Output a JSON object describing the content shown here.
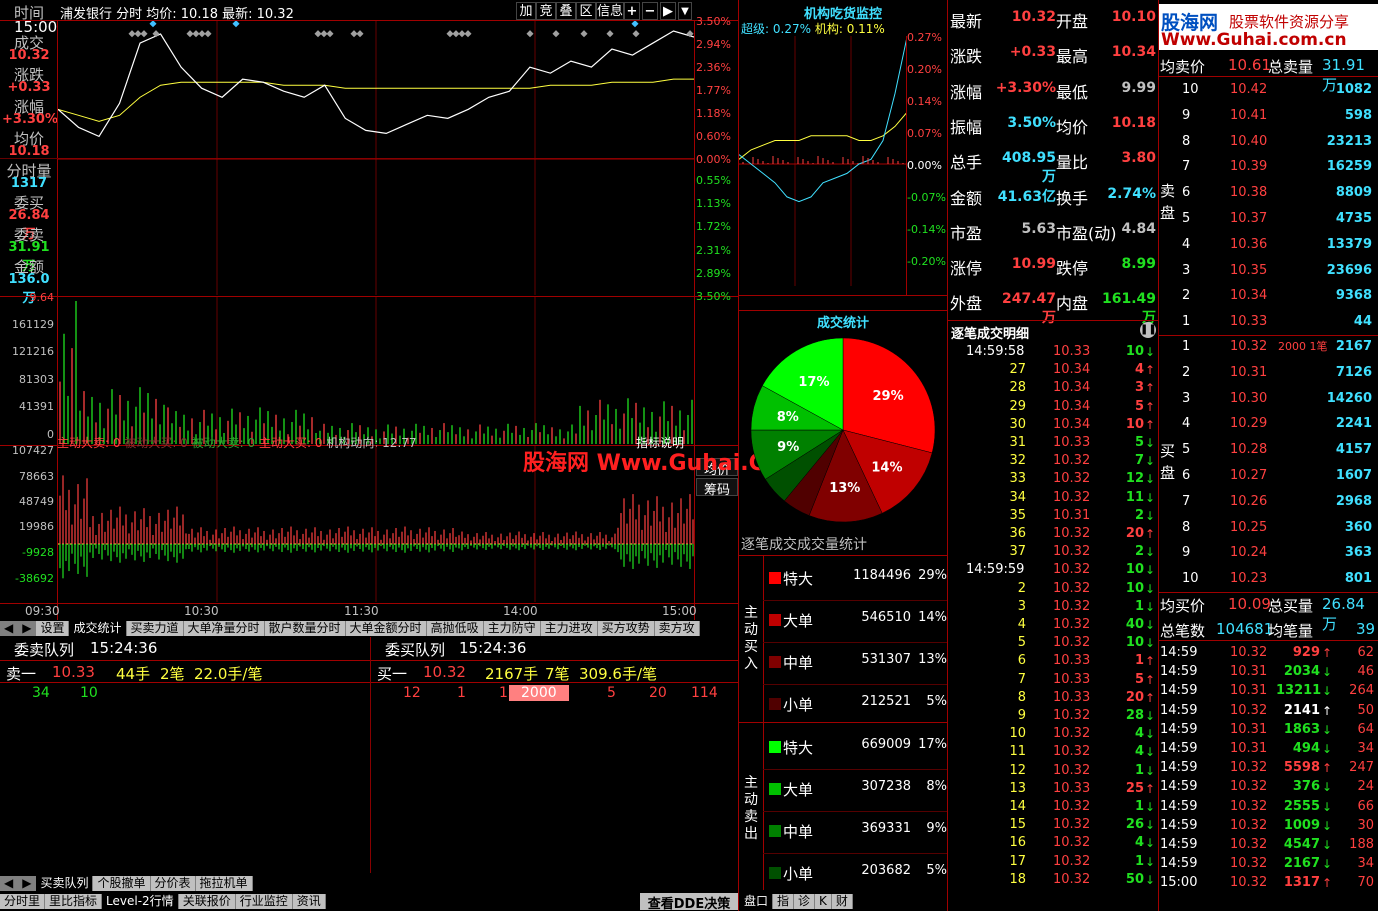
{
  "header": {
    "time_label": "时间",
    "time_value": "15:00",
    "title": "浦发银行 分时 均价: 10.18 最新: 10.32",
    "buttons": [
      "加",
      "竞",
      "叠",
      "区",
      "信息"
    ]
  },
  "left_labels": [
    [
      "成交",
      "10.32",
      "red"
    ],
    [
      "涨跌",
      "+0.33",
      "red"
    ],
    [
      "涨幅",
      "+3.30%",
      "red"
    ],
    [
      "均价",
      "10.18",
      "red"
    ],
    [
      "分时量",
      "1317",
      "cyan"
    ],
    [
      "委买",
      "26.84万",
      "red"
    ],
    [
      "委卖",
      "31.91万",
      "grn"
    ],
    [
      "金额",
      "136.0万",
      "cyan"
    ]
  ],
  "price_axis": {
    "up": [
      "3.50%",
      "2.94%",
      "2.36%",
      "1.77%",
      "1.18%",
      "0.60%",
      "0.00%"
    ],
    "down": [
      "0.55%",
      "1.13%",
      "1.72%",
      "2.31%",
      "2.89%",
      "3.50%"
    ]
  },
  "volume_axis": [
    "9.64",
    "161129",
    "121216",
    "81303",
    "41391",
    "0"
  ],
  "flow_axis": [
    "107427",
    "78663",
    "48749",
    "19986",
    "-9928",
    "-38692"
  ],
  "flow_legend": {
    "a": "主动大卖: 0",
    "b": "被动大买: 0",
    "c": "被动大卖: 0",
    "d": "主动大买: 0",
    "e": "机构动向: 12.77"
  },
  "index_btn": "指标说明",
  "avg_btn": "均价",
  "chip_btn": "筹码",
  "time_axis": [
    "09:30",
    "10:30",
    "11:30",
    "14:00",
    "15:00"
  ],
  "tabs1": [
    "设置",
    "成交统计",
    "买卖力道",
    "大单净量分时",
    "散户数量分时",
    "大单金额分时",
    "高抛低吸",
    "主力防守",
    "主力进攻",
    "买方攻势",
    "卖方攻"
  ],
  "queue_left": {
    "title": "委卖队列",
    "time": "15:24:36",
    "label": "卖一",
    "price": "10.33",
    "lots": "44手",
    "count": "2笔",
    "avg": "22.0手/笔",
    "vals": [
      "34",
      "10"
    ]
  },
  "queue_right": {
    "title": "委买队列",
    "time": "15:24:36",
    "label": "买一",
    "price": "10.32",
    "lots": "2167手",
    "count": "7笔",
    "avg": "309.6手/笔",
    "vals": [
      "12",
      "1",
      "15",
      "2000",
      "5",
      "20",
      "114"
    ]
  },
  "tabs2": [
    "买卖队列",
    "个股撤单",
    "分价表",
    "拖拉机单"
  ],
  "tabs3": [
    "分时里",
    "里比指标",
    "Level-2行情",
    "关联报价",
    "行业监控",
    "资讯"
  ],
  "dde_btn": "查看DDE决策",
  "tabs4": [
    "盘口",
    "指",
    "诊",
    "K",
    "财"
  ],
  "inst": {
    "title": "机构吃货监控",
    "super_label": "超级:",
    "super_val": "0.27%",
    "inst_label": "机构:",
    "inst_val": "0.11%",
    "axis": [
      "0.27%",
      "0.20%",
      "0.14%",
      "0.07%",
      "0.00%",
      "-0.07%",
      "-0.14%",
      "-0.20%"
    ]
  },
  "stats": {
    "title": "成交统计",
    "sub": "逐笔成交成交量统计",
    "buy_label": "主动买入",
    "sell_label": "主动卖出",
    "buy": [
      [
        "特大",
        "1184496",
        "29%",
        "#ff0000"
      ],
      [
        "大单",
        "546510",
        "14%",
        "#c00000"
      ],
      [
        "中单",
        "531307",
        "13%",
        "#800000"
      ],
      [
        "小单",
        "212521",
        "5%",
        "#500000"
      ]
    ],
    "sell": [
      [
        "特大",
        "669009",
        "17%",
        "#00ff00"
      ],
      [
        "大单",
        "307238",
        "8%",
        "#00c000"
      ],
      [
        "中单",
        "369331",
        "9%",
        "#008000"
      ],
      [
        "小单",
        "203682",
        "5%",
        "#005000"
      ]
    ]
  },
  "quote": [
    [
      "最新",
      "10.32",
      "red",
      "开盘",
      "10.10",
      "red"
    ],
    [
      "涨跌",
      "+0.33",
      "red",
      "最高",
      "10.34",
      "red"
    ],
    [
      "涨幅",
      "+3.30%",
      "red",
      "最低",
      "9.99",
      "gray"
    ],
    [
      "振幅",
      "3.50%",
      "cyan",
      "均价",
      "10.18",
      "red"
    ],
    [
      "总手",
      "408.95万",
      "cyan",
      "量比",
      "3.80",
      "red"
    ],
    [
      "金额",
      "41.63亿",
      "cyan",
      "换手",
      "2.74%",
      "cyan"
    ],
    [
      "市盈",
      "5.63",
      "gray",
      "市盈(动)",
      "4.84",
      "gray"
    ],
    [
      "涨停",
      "10.99",
      "red",
      "跌停",
      "8.99",
      "grn"
    ],
    [
      "外盘",
      "247.47万",
      "red",
      "内盘",
      "161.49万",
      "grn"
    ]
  ],
  "ticks_title": "逐笔成交明细",
  "ticks": [
    [
      "14:59:58",
      "10.33",
      "10",
      "d"
    ],
    [
      "27",
      "10.34",
      "4",
      "u"
    ],
    [
      "28",
      "10.34",
      "3",
      "u"
    ],
    [
      "29",
      "10.34",
      "5",
      "u"
    ],
    [
      "30",
      "10.34",
      "10",
      "u"
    ],
    [
      "31",
      "10.33",
      "5",
      "d"
    ],
    [
      "32",
      "10.32",
      "7",
      "d"
    ],
    [
      "33",
      "10.32",
      "12",
      "d"
    ],
    [
      "34",
      "10.32",
      "11",
      "d"
    ],
    [
      "35",
      "10.31",
      "2",
      "d"
    ],
    [
      "36",
      "10.32",
      "20",
      "u"
    ],
    [
      "37",
      "10.32",
      "2",
      "d"
    ],
    [
      "14:59:59",
      "10.32",
      "10",
      "d"
    ],
    [
      "2",
      "10.32",
      "10",
      "d"
    ],
    [
      "3",
      "10.32",
      "1",
      "d"
    ],
    [
      "4",
      "10.32",
      "40",
      "d"
    ],
    [
      "5",
      "10.32",
      "10",
      "d"
    ],
    [
      "6",
      "10.33",
      "1",
      "u"
    ],
    [
      "7",
      "10.33",
      "5",
      "u"
    ],
    [
      "8",
      "10.33",
      "20",
      "u"
    ],
    [
      "9",
      "10.32",
      "28",
      "d"
    ],
    [
      "10",
      "10.32",
      "4",
      "d"
    ],
    [
      "11",
      "10.32",
      "4",
      "d"
    ],
    [
      "12",
      "10.32",
      "1",
      "d"
    ],
    [
      "13",
      "10.33",
      "25",
      "u"
    ],
    [
      "14",
      "10.32",
      "1",
      "d"
    ],
    [
      "15",
      "10.32",
      "26",
      "d"
    ],
    [
      "16",
      "10.32",
      "4",
      "d"
    ],
    [
      "17",
      "10.32",
      "1",
      "d"
    ],
    [
      "18",
      "10.32",
      "50",
      "d"
    ]
  ],
  "book": {
    "brand": "股海网",
    "brand2": "股票软件资源分享",
    "url": "Www.Guhai.com.cn",
    "sell_avg_label": "均卖价",
    "sell_avg": "10.61",
    "sell_tot_label": "总卖量",
    "sell_tot": "31.91万",
    "sell_side": "卖盘",
    "sells": [
      [
        "10",
        "10.42",
        "1082"
      ],
      [
        "9",
        "10.41",
        "598"
      ],
      [
        "8",
        "10.40",
        "23213"
      ],
      [
        "7",
        "10.39",
        "16259"
      ],
      [
        "6",
        "10.38",
        "8809"
      ],
      [
        "5",
        "10.37",
        "4735"
      ],
      [
        "4",
        "10.36",
        "13379"
      ],
      [
        "3",
        "10.35",
        "23696"
      ],
      [
        "2",
        "10.34",
        "9368"
      ],
      [
        "1",
        "10.33",
        "44"
      ]
    ],
    "buy_side": "买盘",
    "buys": [
      [
        "1",
        "10.32",
        "2000 1笔",
        "2167"
      ],
      [
        "2",
        "10.31",
        "",
        "7126"
      ],
      [
        "3",
        "10.30",
        "",
        "14260"
      ],
      [
        "4",
        "10.29",
        "",
        "2241"
      ],
      [
        "5",
        "10.28",
        "",
        "4157"
      ],
      [
        "6",
        "10.27",
        "",
        "1607"
      ],
      [
        "7",
        "10.26",
        "",
        "2968"
      ],
      [
        "8",
        "10.25",
        "",
        "360"
      ],
      [
        "9",
        "10.24",
        "",
        "363"
      ],
      [
        "10",
        "10.23",
        "",
        "801"
      ]
    ],
    "buy_avg_label": "均买价",
    "buy_avg": "10.09",
    "buy_tot_label": "总买量",
    "buy_tot": "26.84万",
    "cnt_label": "总笔数",
    "cnt": "104681",
    "avgc_label": "均笔量",
    "avgc": "39",
    "deals": [
      [
        "14:59",
        "10.32",
        "929",
        "u",
        "62"
      ],
      [
        "14:59",
        "10.31",
        "2034",
        "d",
        "46"
      ],
      [
        "14:59",
        "10.31",
        "13211",
        "d",
        "264"
      ],
      [
        "14:59",
        "10.32",
        "2141",
        "u",
        "50"
      ],
      [
        "14:59",
        "10.31",
        "1863",
        "d",
        "64"
      ],
      [
        "14:59",
        "10.31",
        "494",
        "d",
        "34"
      ],
      [
        "14:59",
        "10.32",
        "5598",
        "u",
        "247"
      ],
      [
        "14:59",
        "10.32",
        "376",
        "d",
        "24"
      ],
      [
        "14:59",
        "10.32",
        "2555",
        "d",
        "66"
      ],
      [
        "14:59",
        "10.32",
        "1009",
        "d",
        "30"
      ],
      [
        "14:59",
        "10.32",
        "4547",
        "d",
        "188"
      ],
      [
        "14:59",
        "10.32",
        "2167",
        "d",
        "34"
      ],
      [
        "15:00",
        "10.32",
        "1317",
        "u",
        "70"
      ]
    ]
  },
  "watermark": "股海网 Www.Guhai.Com.CN",
  "chart_data": {
    "type": "line",
    "title": "浦发银行 分时",
    "x": [
      "09:30",
      "10:30",
      "11:30",
      "14:00",
      "15:00"
    ],
    "price": [
      10.08,
      10.02,
      9.99,
      10.1,
      10.3,
      10.33,
      10.22,
      10.15,
      10.12,
      10.18,
      10.17,
      10.14,
      10.12,
      10.16,
      10.05,
      10.01,
      10.0,
      10.03,
      10.06,
      10.05,
      10.08,
      10.12,
      10.14,
      10.22,
      10.2,
      10.24,
      10.22,
      10.28,
      10.26,
      10.3,
      10.34,
      10.32
    ],
    "avg": [
      10.08,
      10.06,
      10.04,
      10.06,
      10.12,
      10.16,
      10.17,
      10.17,
      10.17,
      10.17,
      10.17,
      10.16,
      10.16,
      10.16,
      10.15,
      10.15,
      10.15,
      10.15,
      10.15,
      10.15,
      10.15,
      10.15,
      10.15,
      10.15,
      10.16,
      10.16,
      10.16,
      10.17,
      10.17,
      10.17,
      10.18,
      10.18
    ],
    "ylim": [
      9.64,
      10.34
    ],
    "pie": [
      {
        "name": "主动买入特大",
        "value": 29,
        "color": "#ff0000"
      },
      {
        "name": "主动买入大单",
        "value": 14,
        "color": "#c00000"
      },
      {
        "name": "主动买入中单",
        "value": 13,
        "color": "#800000"
      },
      {
        "name": "主动买入小单",
        "value": 5,
        "color": "#500000"
      },
      {
        "name": "主动卖出小单",
        "value": 5,
        "color": "#005000"
      },
      {
        "name": "主动卖出中单",
        "value": 9,
        "color": "#008000"
      },
      {
        "name": "主动卖出大单",
        "value": 8,
        "color": "#00c000"
      },
      {
        "name": "主动卖出特大",
        "value": 17,
        "color": "#00ff00"
      }
    ]
  }
}
